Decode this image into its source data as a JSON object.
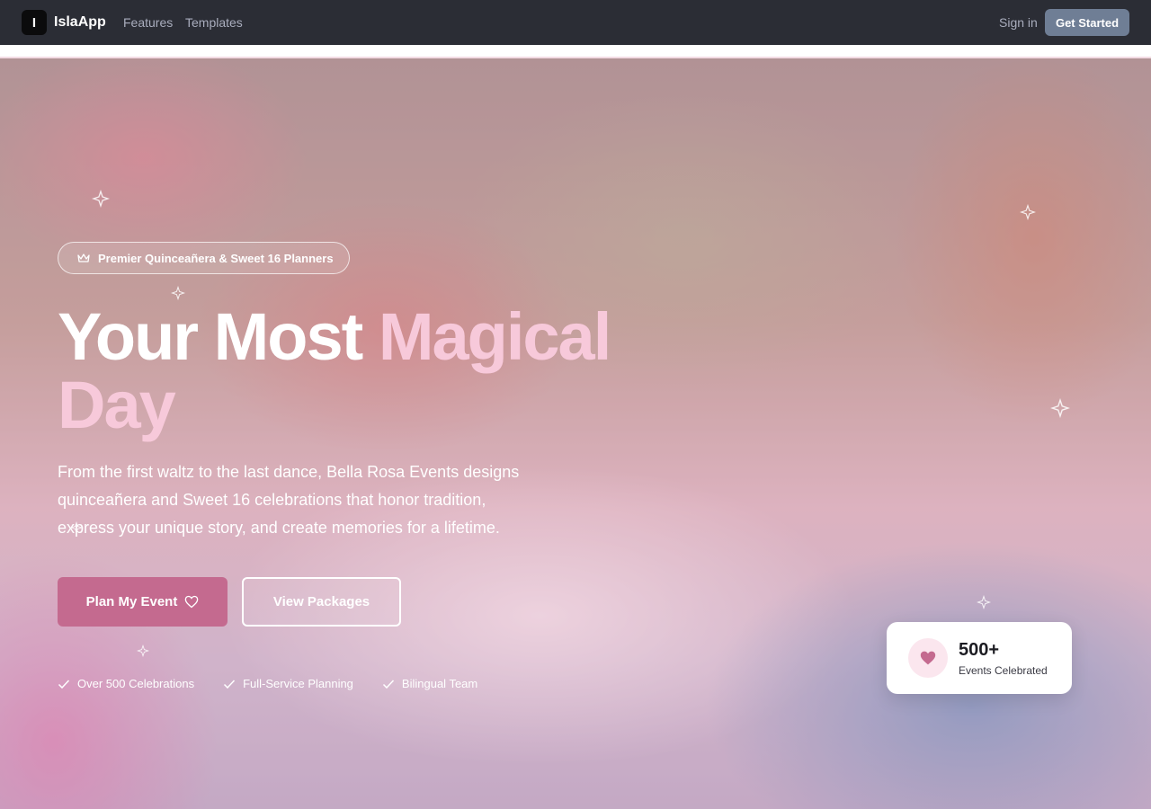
{
  "appbar": {
    "logo_letter": "I",
    "app_name": "IslaApp",
    "nav": [
      "Features",
      "Templates"
    ],
    "sign_in": "Sign in",
    "get_started": "Get Started"
  },
  "hero": {
    "tagline": "Premier Quinceañera & Sweet 16 Planners",
    "headline_part1": "Your Most ",
    "headline_accent_1": "Magical",
    "headline_accent_2": "Day",
    "subtext": "From the first waltz to the last dance, Bella Rosa Events designs quinceañera and Sweet 16 celebrations that honor tradition, express your unique story, and create memories for a lifetime.",
    "primary_button": "Plan My Event",
    "secondary_button": "View Packages",
    "features": [
      "Over 500 Celebrations",
      "Full-Service Planning",
      "Bilingual Team"
    ]
  },
  "stat": {
    "value": "500+",
    "label": "Events Celebrated"
  },
  "colors": {
    "accent": "#c46a8f",
    "accent_light": "#f7c9da",
    "appbar_bg": "#2b2d35",
    "get_started_bg": "#6f7e95"
  }
}
